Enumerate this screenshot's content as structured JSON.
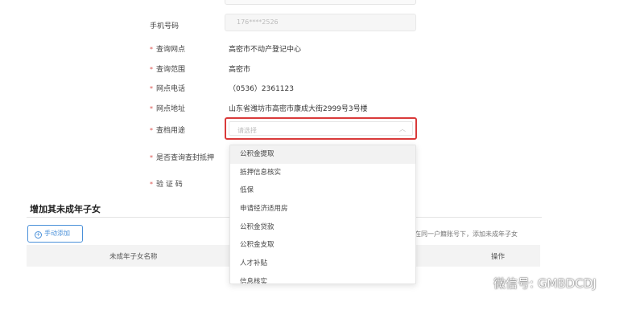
{
  "form": {
    "phone": {
      "label": "手机号码",
      "value": "176****2526"
    },
    "site": {
      "label": "查询网点",
      "value": "高密市不动产登记中心"
    },
    "scope": {
      "label": "查询范围",
      "value": "高密市"
    },
    "tel": {
      "label": "网点电话",
      "value": "（0536）2361123"
    },
    "address": {
      "label": "网点地址",
      "value": "山东省潍坊市高密市康成大街2999号3号楼"
    },
    "purpose": {
      "label": "查档用途",
      "placeholder": "请选择"
    },
    "seal": {
      "label": "是否查询查封抵押"
    },
    "captcha": {
      "label": "验 证 码"
    },
    "required_mark": "*"
  },
  "dropdown": {
    "options": [
      "公积金提取",
      "抵押信息核实",
      "低保",
      "申请经济适用房",
      "公积金贷款",
      "公积金支取",
      "人才补贴",
      "信息核实"
    ],
    "hovered_index": 0
  },
  "children_section": {
    "title": "增加其未成年子女",
    "add_button": "手动添加",
    "hint": "在同一户籍账号下，添加未成年子女",
    "columns": [
      "未成年子女名称",
      "操作"
    ]
  },
  "watermark": {
    "text": "微信号: GMBDCDJ"
  },
  "colors": {
    "highlight_border": "#d93a3a",
    "accent": "#4a90d9"
  }
}
